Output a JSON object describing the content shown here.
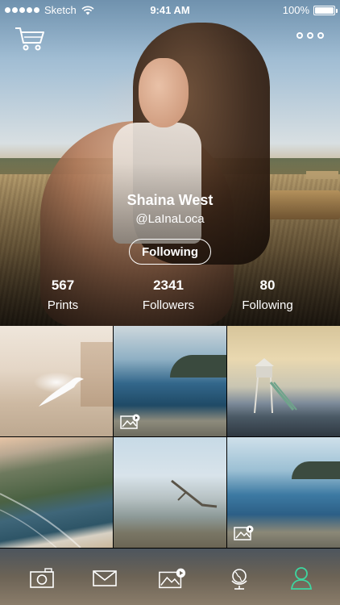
{
  "status_bar": {
    "carrier": "Sketch",
    "time": "9:41 AM",
    "battery": "100%"
  },
  "header": {
    "cart_icon": "cart-icon",
    "more_icon": "more-dots-icon"
  },
  "profile": {
    "name": "Shaina West",
    "handle": "@LaInaLoca",
    "follow_button": "Following"
  },
  "stats": [
    {
      "value": "567",
      "label": "Prints"
    },
    {
      "value": "2341",
      "label": "Followers"
    },
    {
      "value": "80",
      "label": "Following"
    }
  ],
  "gallery": {
    "tiles": [
      {
        "subject": "seagull-on-beach",
        "badge": false
      },
      {
        "subject": "river-estuary",
        "badge": true
      },
      {
        "subject": "lifeguard-tower",
        "badge": false
      },
      {
        "subject": "aerial-coastline",
        "badge": false
      },
      {
        "subject": "driftwood-shore",
        "badge": false
      },
      {
        "subject": "river-estuary-2",
        "badge": true
      }
    ]
  },
  "tab_bar": {
    "items": [
      {
        "icon": "camera-icon",
        "active": false
      },
      {
        "icon": "mail-icon",
        "active": false
      },
      {
        "icon": "gallery-icon",
        "active": false
      },
      {
        "icon": "globe-icon",
        "active": false
      },
      {
        "icon": "profile-icon",
        "active": true
      }
    ],
    "active_color": "#3dd6a0",
    "inactive_color": "#ffffff"
  }
}
